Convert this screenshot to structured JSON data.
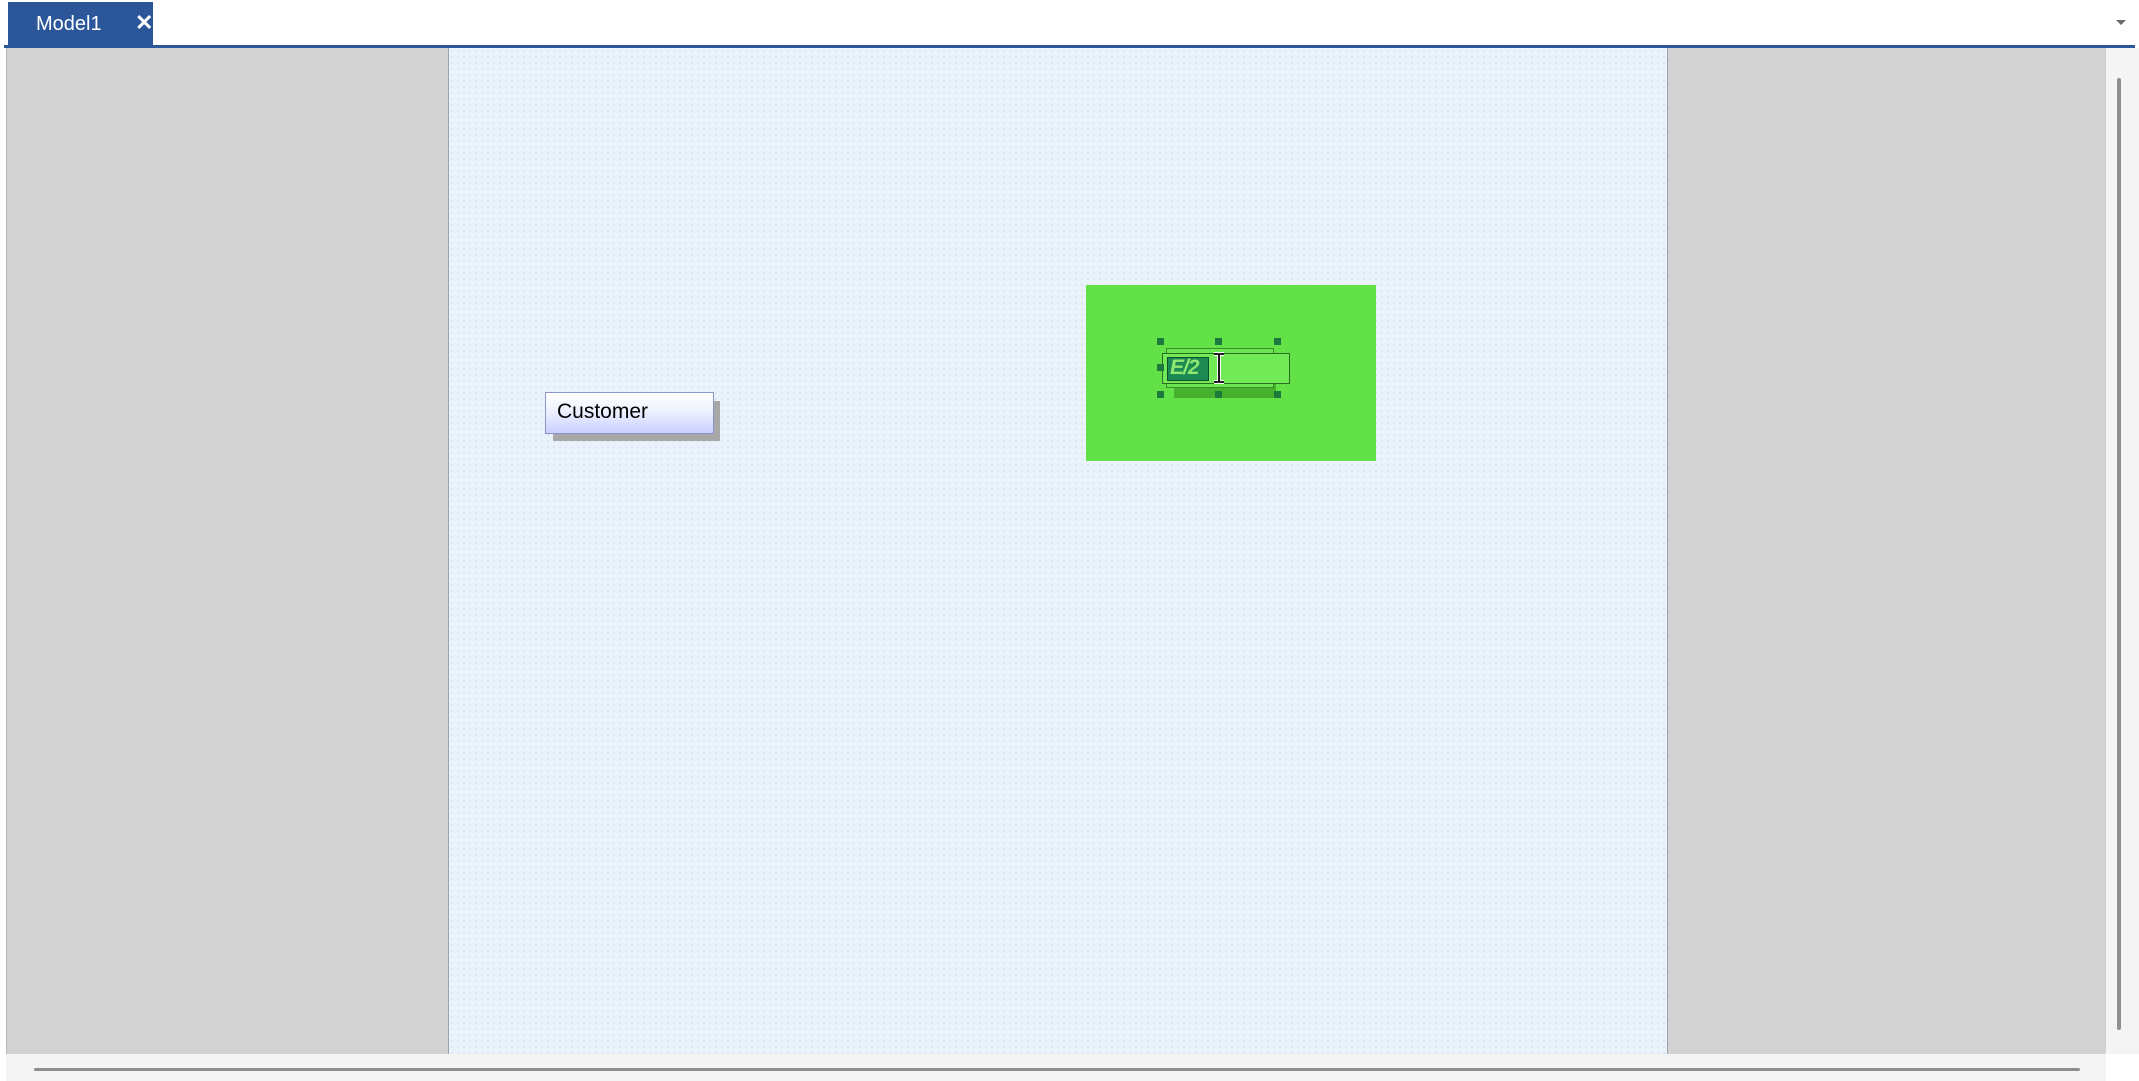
{
  "tabs": [
    {
      "label": "Model1",
      "active": true
    }
  ],
  "tab_close_symbol": "✕",
  "diagram": {
    "entities": [
      {
        "label": "Customer"
      }
    ],
    "selected_text_editor": {
      "text": "E/2"
    }
  },
  "icons": {
    "tab_close": "close-icon",
    "tab_list": "chevron-down-icon",
    "text_cursor": "i-beam-cursor-icon"
  },
  "colors": {
    "tab_active": "#2b579a",
    "canvas": "#eaf3fb",
    "workspace": "#d2d2d2",
    "selection_highlight": "#62e246",
    "entity_gradient_end": "#c8d0ff"
  }
}
